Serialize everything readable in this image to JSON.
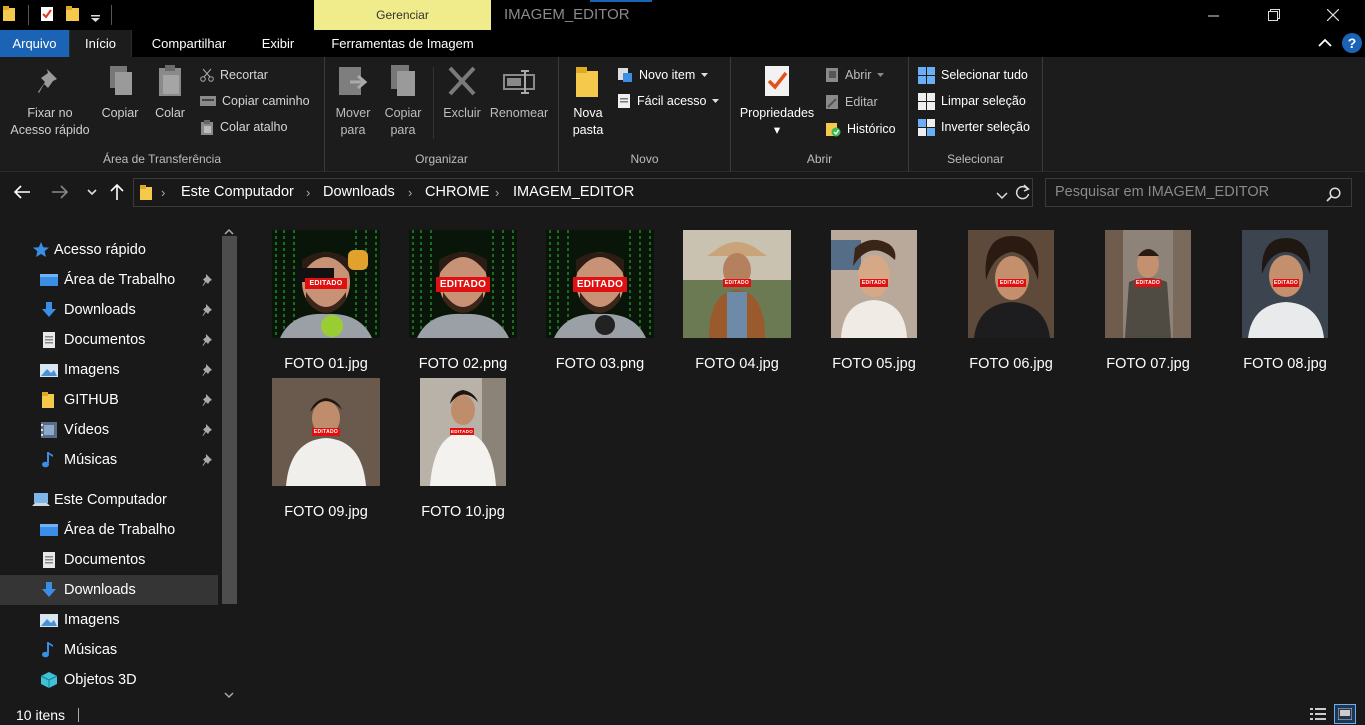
{
  "window": {
    "context_tab": "Gerenciar",
    "title": "IMAGEM_EDITOR",
    "controls": [
      "minimize-icon",
      "maximize-icon",
      "close-icon"
    ]
  },
  "ribbon_tabs": [
    "Arquivo",
    "Início",
    "Compartilhar",
    "Exibir",
    "Ferramentas de Imagem"
  ],
  "ribbon": {
    "clipboard": {
      "label": "Área de Transferência",
      "pin_line1": "Fixar no",
      "pin_line2": "Acesso rápido",
      "copy": "Copiar",
      "paste": "Colar",
      "cut": "Recortar",
      "copy_path": "Copiar caminho",
      "paste_shortcut": "Colar atalho"
    },
    "organize": {
      "label": "Organizar",
      "move_line1": "Mover",
      "move_line2": "para",
      "copy_line1": "Copiar",
      "copy_line2": "para",
      "delete": "Excluir",
      "rename": "Renomear"
    },
    "new": {
      "label": "Novo",
      "folder_line1": "Nova",
      "folder_line2": "pasta",
      "new_item": "Novo item",
      "easy_access": "Fácil acesso"
    },
    "open": {
      "label": "Abrir",
      "properties": "Propriedades",
      "open": "Abrir",
      "edit": "Editar",
      "history": "Histórico"
    },
    "select": {
      "label": "Selecionar",
      "select_all": "Selecionar tudo",
      "select_none": "Limpar seleção",
      "invert": "Inverter seleção"
    }
  },
  "address": {
    "crumbs": [
      "Este Computador",
      "Downloads",
      "CHROME",
      "IMAGEM_EDITOR"
    ],
    "search_placeholder": "Pesquisar em IMAGEM_EDITOR"
  },
  "sidebar": {
    "quick_access": "Acesso rápido",
    "quick_items": [
      "Área de Trabalho",
      "Downloads",
      "Documentos",
      "Imagens",
      "GITHUB",
      "Vídeos",
      "Músicas"
    ],
    "this_pc": "Este Computador",
    "pc_items": [
      "Área de Trabalho",
      "Documentos",
      "Downloads",
      "Imagens",
      "Músicas",
      "Objetos 3D"
    ],
    "selected": "Downloads"
  },
  "files": [
    {
      "name": "FOTO 01.jpg",
      "badge": "EDITADO"
    },
    {
      "name": "FOTO 02.png",
      "badge": "EDITADO"
    },
    {
      "name": "FOTO 03.png",
      "badge": "EDITADO"
    },
    {
      "name": "FOTO 04.jpg",
      "badge": "EDITADO"
    },
    {
      "name": "FOTO 05.jpg",
      "badge": "EDITADO"
    },
    {
      "name": "FOTO 06.jpg",
      "badge": "EDITADO"
    },
    {
      "name": "FOTO 07.jpg",
      "badge": "EDITADO"
    },
    {
      "name": "FOTO 08.jpg",
      "badge": "EDITADO"
    },
    {
      "name": "FOTO 09.jpg",
      "badge": "EDITADO"
    },
    {
      "name": "FOTO 10.jpg",
      "badge": "EDITADO"
    }
  ],
  "status": {
    "count": "10 itens"
  },
  "colors": {
    "accent": "#1b63b5",
    "context_tab": "#f0ec8c",
    "folder": "#f5c94b",
    "badge": "#e01010"
  }
}
